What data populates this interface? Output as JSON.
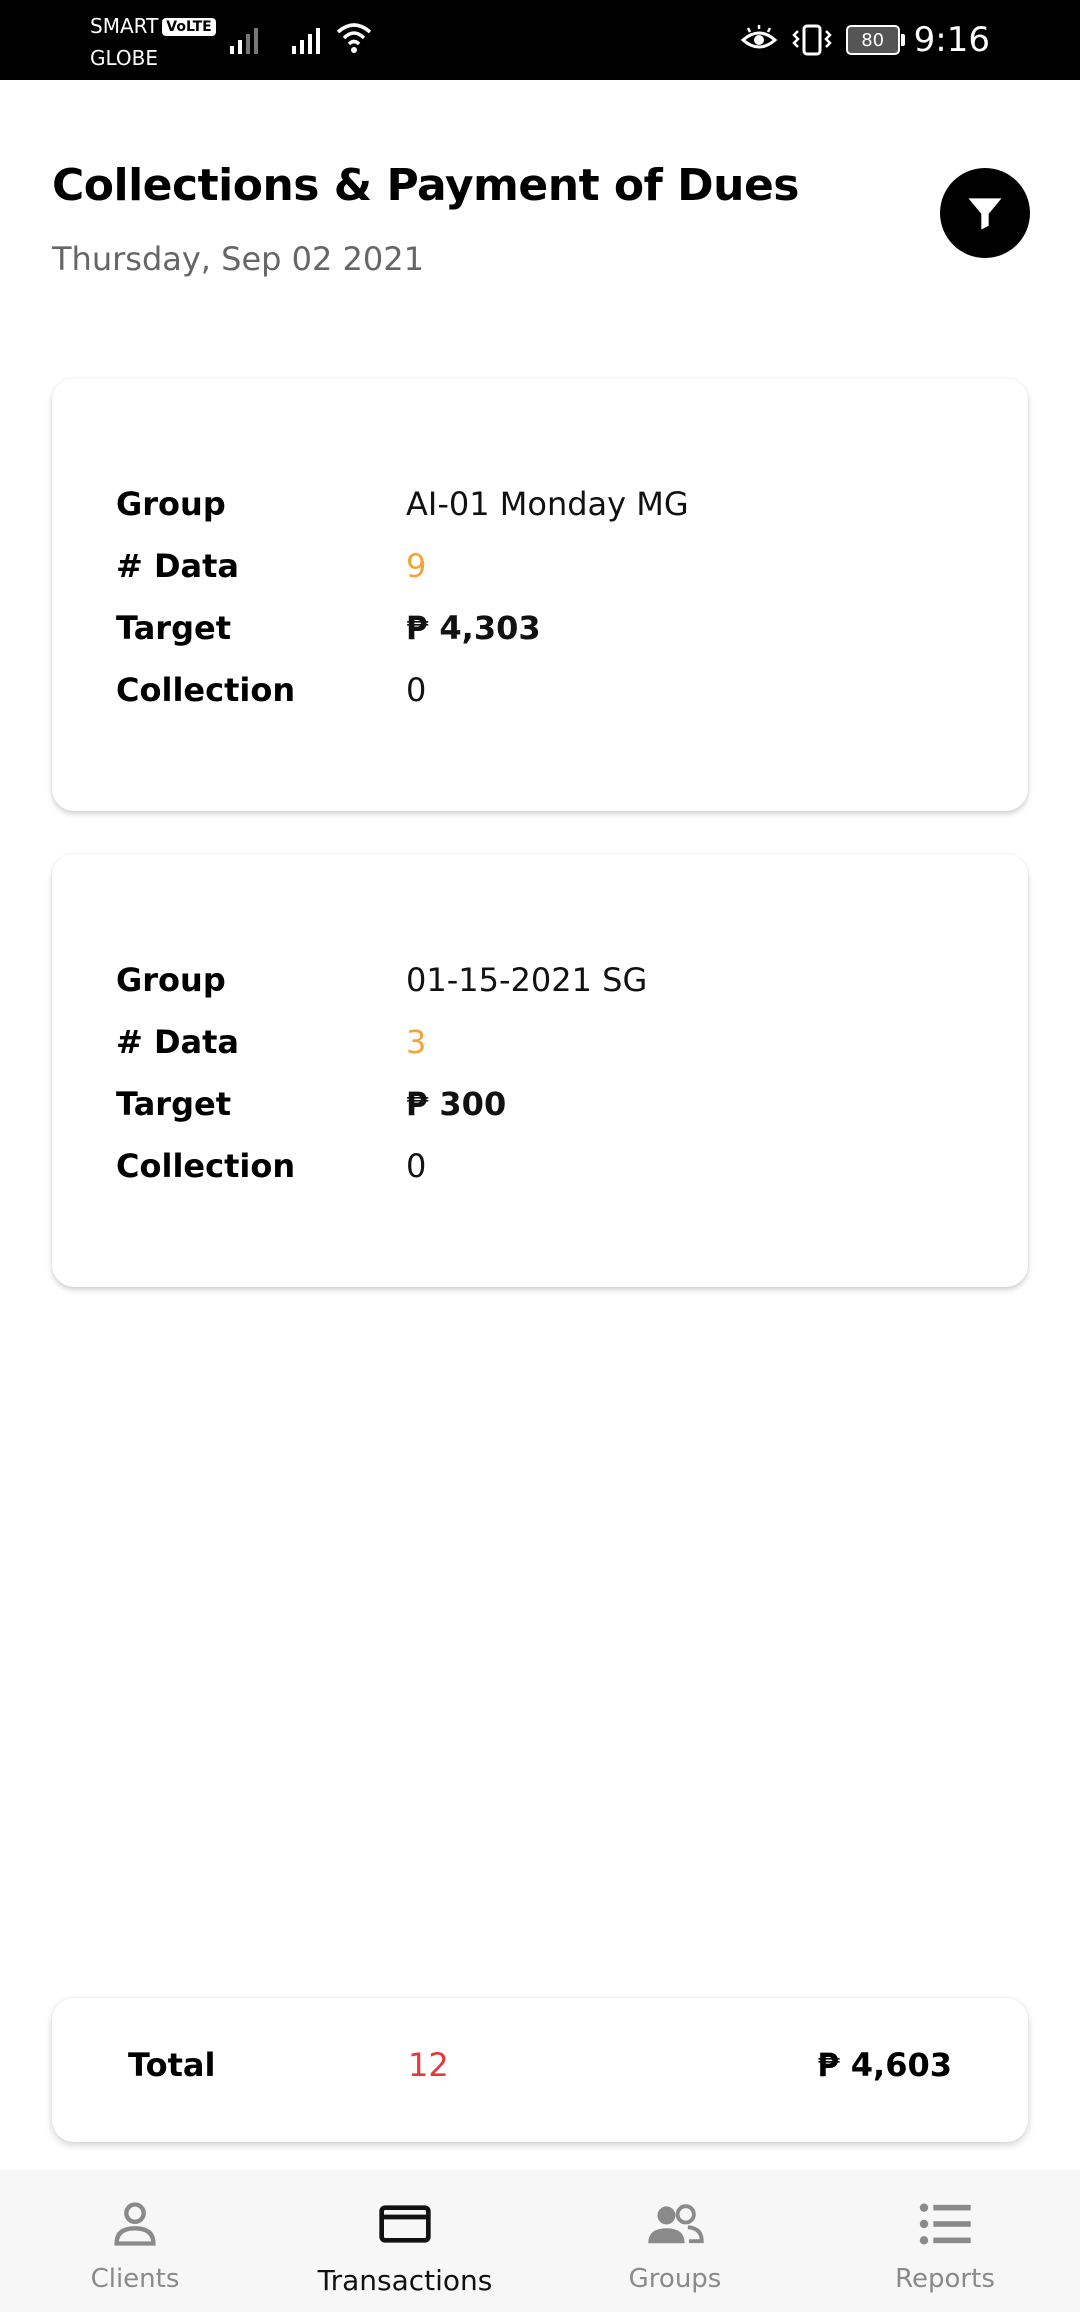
{
  "status_bar": {
    "carrier_1": "SMART",
    "volte_badge": "VoLTE",
    "carrier_2": "GLOBE",
    "battery": "80",
    "time": "9:16"
  },
  "header": {
    "title": "Collections & Payment of Dues",
    "date": "Thursday, Sep 02 2021"
  },
  "cards": [
    {
      "group_label": "Group",
      "group_value": "AI-01 Monday MG",
      "data_label": "# Data",
      "data_value": "9",
      "target_label": "Target",
      "target_value": "₱ 4,303",
      "collection_label": "Collection",
      "collection_value": "0"
    },
    {
      "group_label": "Group",
      "group_value": "01-15-2021 SG",
      "data_label": "# Data",
      "data_value": "3",
      "target_label": "Target",
      "target_value": "₱ 300",
      "collection_label": "Collection",
      "collection_value": "0"
    }
  ],
  "total": {
    "label": "Total",
    "count": "12",
    "amount": "₱ 4,603"
  },
  "bottom_nav": {
    "items": [
      {
        "label": "Clients",
        "icon": "person-icon"
      },
      {
        "label": "Transactions",
        "icon": "card-icon",
        "active": true
      },
      {
        "label": "Groups",
        "icon": "group-icon"
      },
      {
        "label": "Reports",
        "icon": "list-icon"
      }
    ]
  },
  "colors": {
    "accent_orange": "#f2a43a",
    "total_count_red": "#e53935",
    "nav_inactive": "#8a8a8a",
    "status_bar_bg": "#000000"
  }
}
